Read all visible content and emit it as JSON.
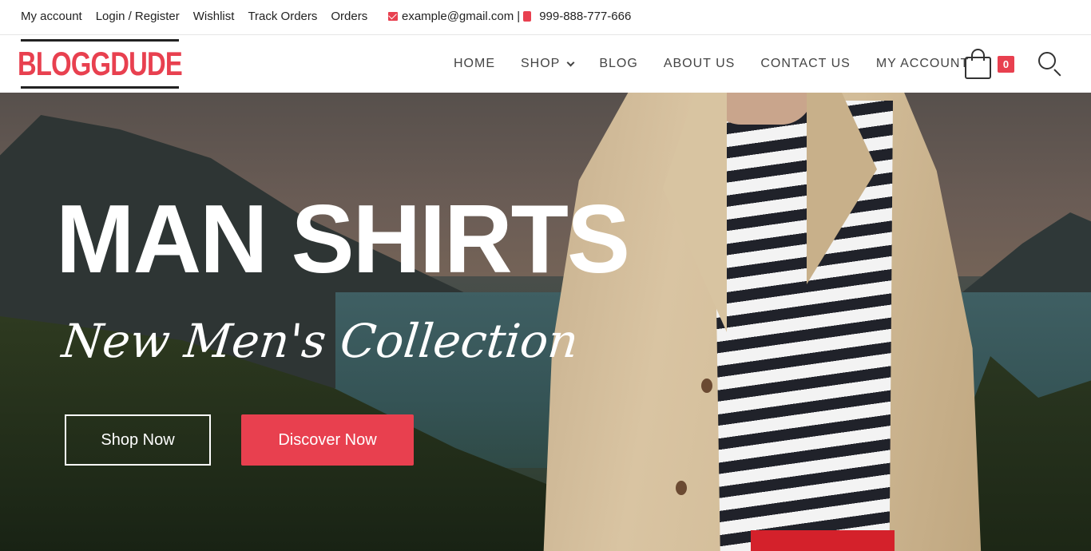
{
  "topbar": {
    "links": [
      "My account",
      "Login / Register",
      "Wishlist",
      "Track Orders",
      "Orders"
    ],
    "email": "example@gmail.com",
    "separator": "|",
    "phone": "999-888-777-666"
  },
  "header": {
    "logo": "BLOGGDUDE",
    "nav": [
      "HOME",
      "SHOP",
      "BLOG",
      "ABOUT US",
      "CONTACT US",
      "MY ACCOUNT"
    ],
    "cart_count": "0"
  },
  "hero": {
    "title": "MAN SHIRTS",
    "subtitle": "New Men's Collection",
    "primary_button": "Shop Now",
    "secondary_button": "Discover Now"
  },
  "icons": {
    "email": "mail-icon",
    "phone": "phone-icon",
    "cart": "shopping-bag-icon",
    "search": "search-icon",
    "dropdown": "chevron-down-icon"
  },
  "colors": {
    "accent": "#e8404f",
    "text": "#222222",
    "nav_text": "#444444",
    "hero_text": "#ffffff"
  }
}
